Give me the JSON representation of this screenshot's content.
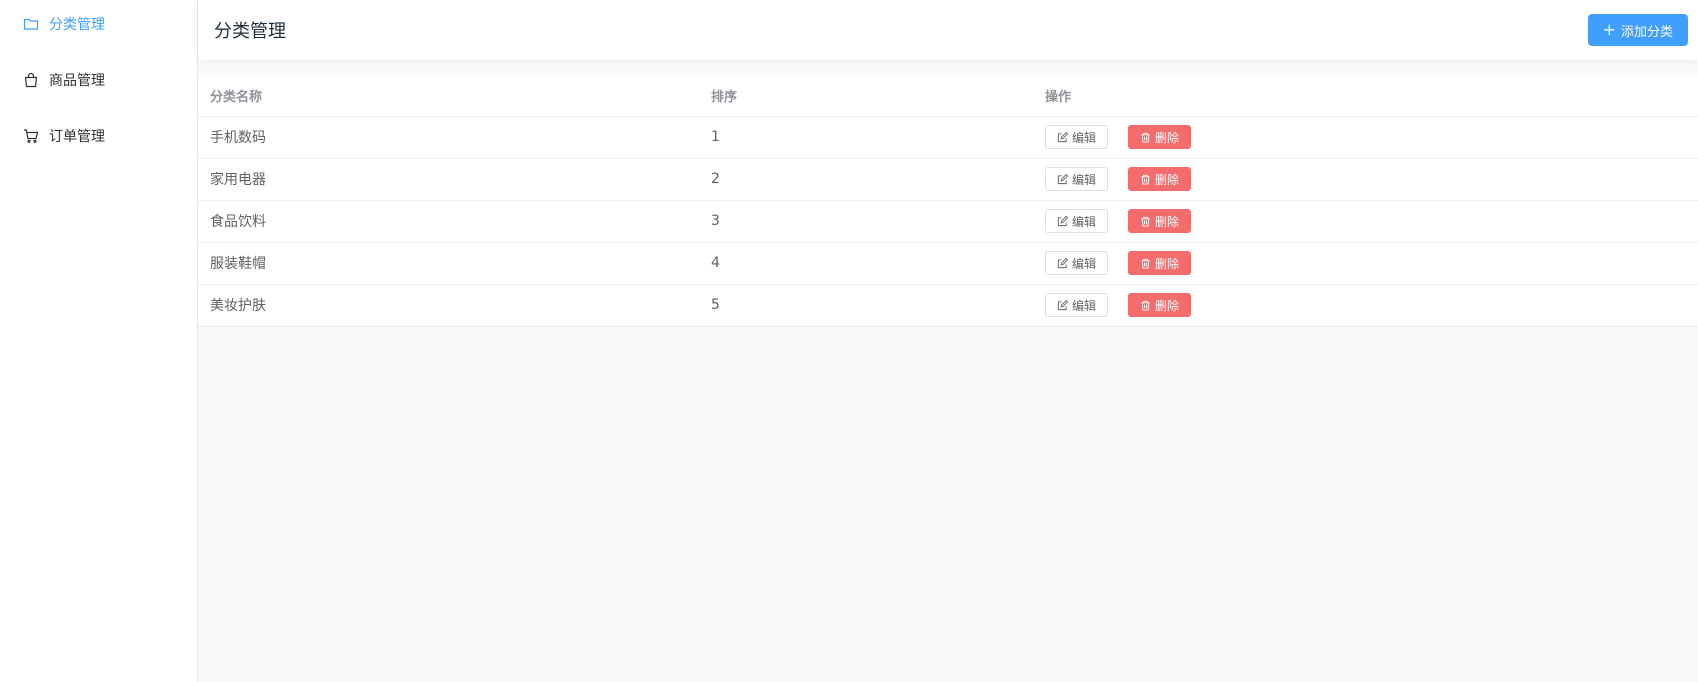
{
  "sidebar": {
    "items": [
      {
        "label": "分类管理",
        "icon": "folder-icon",
        "active": true
      },
      {
        "label": "商品管理",
        "icon": "shopping-bag-icon",
        "active": false
      },
      {
        "label": "订单管理",
        "icon": "shopping-cart-icon",
        "active": false
      }
    ]
  },
  "header": {
    "title": "分类管理",
    "add_button_label": "添加分类"
  },
  "table": {
    "columns": [
      "分类名称",
      "排序",
      "操作"
    ],
    "rows": [
      {
        "name": "手机数码",
        "sort": "1"
      },
      {
        "name": "家用电器",
        "sort": "2"
      },
      {
        "name": "食品饮料",
        "sort": "3"
      },
      {
        "name": "服装鞋帽",
        "sort": "4"
      },
      {
        "name": "美妆护肤",
        "sort": "5"
      }
    ],
    "edit_label": "编辑",
    "delete_label": "删除"
  },
  "colors": {
    "accent": "#409eff",
    "danger": "#f56c6c"
  }
}
